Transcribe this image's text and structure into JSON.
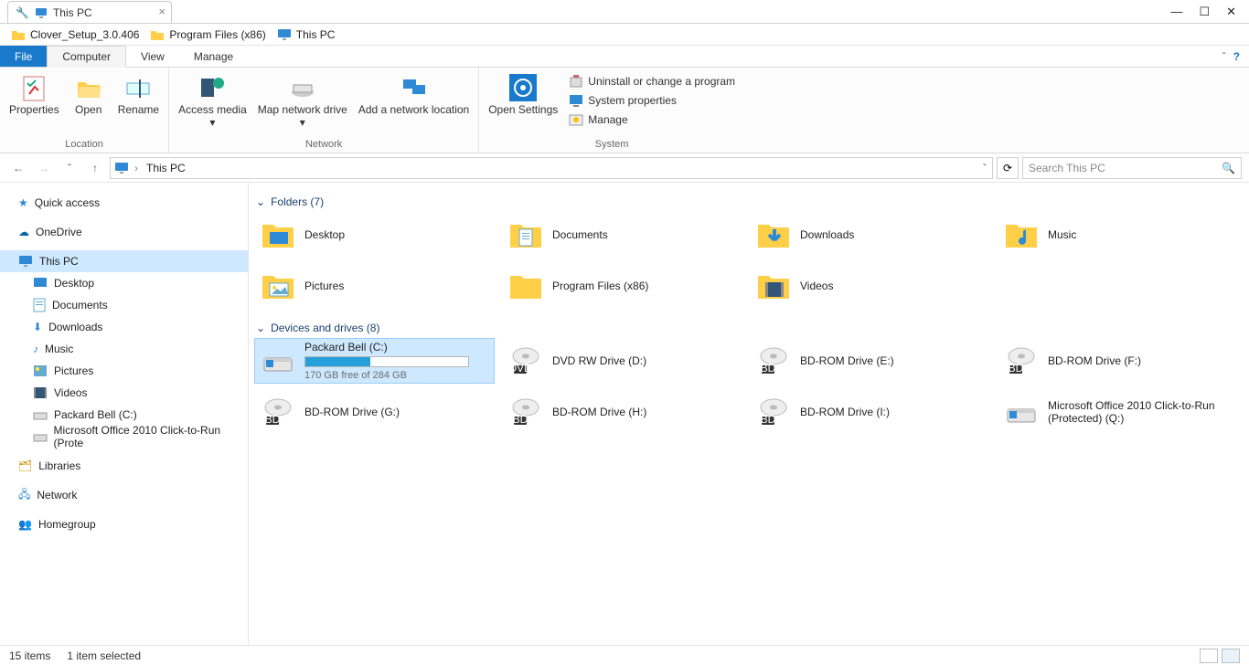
{
  "window": {
    "title": "This PC"
  },
  "bookmarks": [
    {
      "label": "Clover_Setup_3.0.406",
      "icon": "folder"
    },
    {
      "label": "Program Files (x86)",
      "icon": "folder"
    },
    {
      "label": "This PC",
      "icon": "monitor"
    }
  ],
  "ribbon_tabs": {
    "file": "File",
    "computer": "Computer",
    "view": "View",
    "manage": "Manage"
  },
  "ribbon": {
    "location": {
      "group": "Location",
      "properties": "Properties",
      "open": "Open",
      "rename": "Rename"
    },
    "network": {
      "group": "Network",
      "access_media": "Access media",
      "map_drive": "Map network drive",
      "add_location": "Add a network location"
    },
    "system": {
      "group": "System",
      "open_settings": "Open Settings",
      "uninstall": "Uninstall or change a program",
      "sys_props": "System properties",
      "manage": "Manage"
    }
  },
  "address": {
    "location": "This PC"
  },
  "search": {
    "placeholder": "Search This PC"
  },
  "tree": {
    "quick_access": "Quick access",
    "onedrive": "OneDrive",
    "this_pc": "This PC",
    "desktop": "Desktop",
    "documents": "Documents",
    "downloads": "Downloads",
    "music": "Music",
    "pictures": "Pictures",
    "videos": "Videos",
    "packard": "Packard Bell (C:)",
    "office": "Microsoft Office 2010 Click-to-Run (Prote",
    "libraries": "Libraries",
    "network": "Network",
    "homegroup": "Homegroup"
  },
  "sections": {
    "folders": {
      "title": "Folders (7)"
    },
    "drives": {
      "title": "Devices and drives (8)"
    }
  },
  "folders": [
    {
      "label": "Desktop"
    },
    {
      "label": "Documents"
    },
    {
      "label": "Downloads"
    },
    {
      "label": "Music"
    },
    {
      "label": "Pictures"
    },
    {
      "label": "Program Files (x86)"
    },
    {
      "label": "Videos"
    }
  ],
  "drives": [
    {
      "label": "Packard Bell (C:)",
      "sub": "170 GB free of 284 GB",
      "fill_pct": 40,
      "type": "hdd",
      "selected": true
    },
    {
      "label": "DVD RW Drive (D:)",
      "type": "dvd"
    },
    {
      "label": "BD-ROM Drive (E:)",
      "type": "bd"
    },
    {
      "label": "BD-ROM Drive (F:)",
      "type": "bd"
    },
    {
      "label": "BD-ROM Drive (G:)",
      "type": "bd"
    },
    {
      "label": "BD-ROM Drive (H:)",
      "type": "bd"
    },
    {
      "label": "BD-ROM Drive (I:)",
      "type": "bd"
    },
    {
      "label": "Microsoft Office 2010 Click-to-Run (Protected) (Q:)",
      "type": "hdd"
    }
  ],
  "status": {
    "items": "15 items",
    "selected": "1 item selected"
  }
}
